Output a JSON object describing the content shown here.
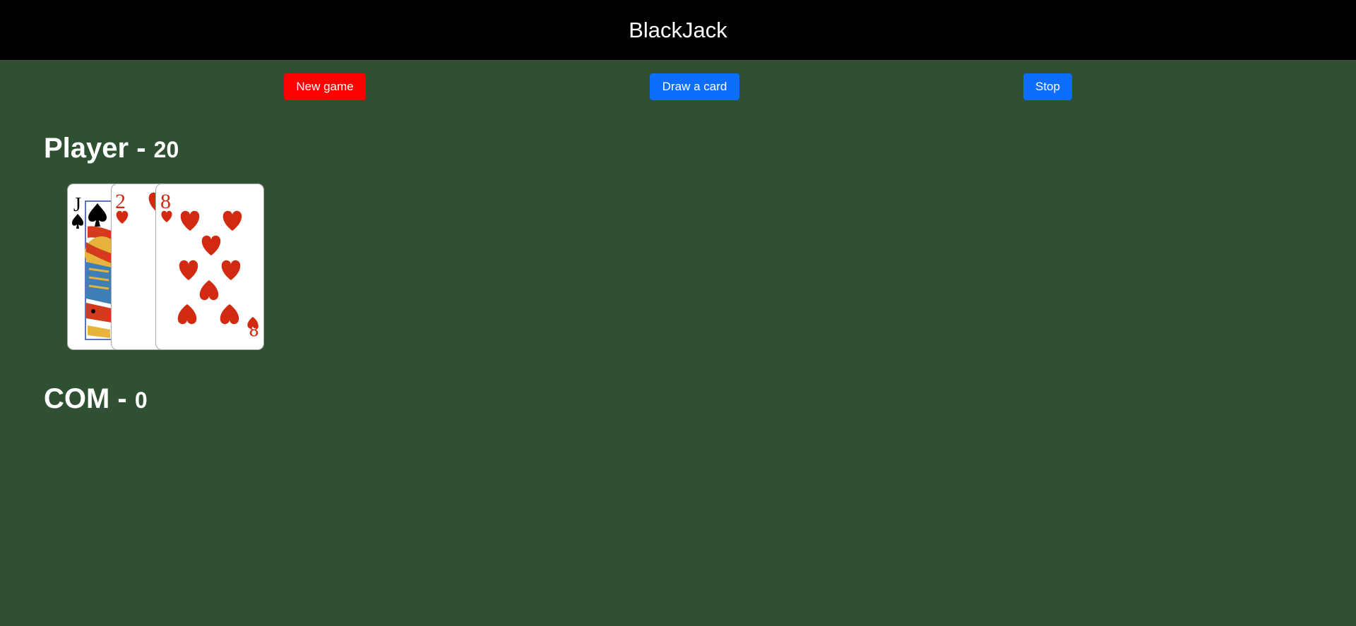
{
  "app": {
    "title": "BlackJack"
  },
  "controls": {
    "new_game_label": "New game",
    "draw_label": "Draw a card",
    "stop_label": "Stop"
  },
  "player": {
    "label": "Player -",
    "score": "20",
    "cards": [
      {
        "rank": "J",
        "suit": "spades"
      },
      {
        "rank": "2",
        "suit": "hearts"
      },
      {
        "rank": "8",
        "suit": "hearts"
      }
    ]
  },
  "com": {
    "label": "COM -",
    "score": "0",
    "cards": []
  },
  "colors": {
    "table": "#2f5032",
    "topbar": "#000000",
    "new_game_button": "#ff0000",
    "action_button": "#0d6efd",
    "heart": "#d12a10",
    "spade": "#000000"
  },
  "icons": {
    "heart": "heart-icon",
    "spade": "spade-icon"
  }
}
